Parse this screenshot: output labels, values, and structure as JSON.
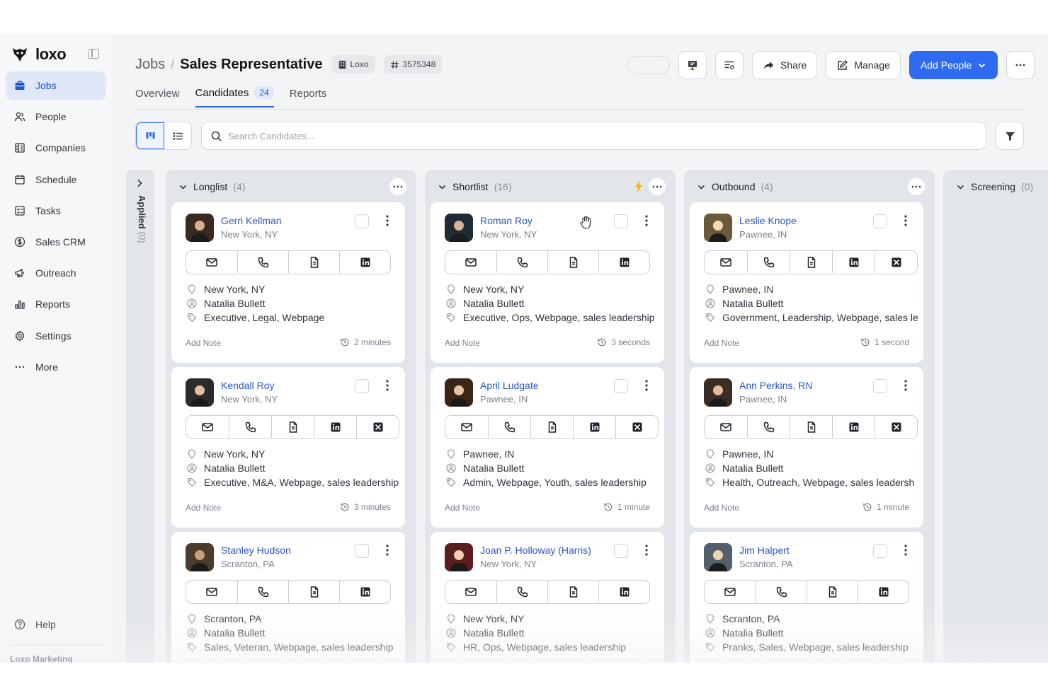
{
  "app": {
    "logo_text": "loxo"
  },
  "sidebar": {
    "items": [
      {
        "label": "Jobs",
        "icon": "briefcase-icon",
        "active": true
      },
      {
        "label": "People",
        "icon": "people-icon"
      },
      {
        "label": "Companies",
        "icon": "building-icon"
      },
      {
        "label": "Schedule",
        "icon": "calendar-icon"
      },
      {
        "label": "Tasks",
        "icon": "tasks-icon"
      },
      {
        "label": "Sales CRM",
        "icon": "dollar-icon"
      },
      {
        "label": "Outreach",
        "icon": "megaphone-icon"
      },
      {
        "label": "Reports",
        "icon": "bar-chart-icon"
      },
      {
        "label": "Settings",
        "icon": "gear-icon"
      },
      {
        "label": "More",
        "icon": "more-icon"
      }
    ],
    "help_label": "Help",
    "org_label": "Loxo Marketing"
  },
  "header": {
    "breadcrumb_root": "Jobs",
    "breadcrumb_sep": "/",
    "title": "Sales Representative",
    "company_chip": "Loxo",
    "id_chip": "3575348",
    "share_label": "Share",
    "manage_label": "Manage",
    "add_people_label": "Add People"
  },
  "tabs": {
    "overview": "Overview",
    "candidates": "Candidates",
    "candidates_count": "24",
    "reports": "Reports"
  },
  "search": {
    "placeholder": "Search Candidates..."
  },
  "board": {
    "applied": {
      "label": "Applied",
      "count": "(0)"
    },
    "columns": [
      {
        "title": "Longlist",
        "count": "(4)",
        "cards": [
          {
            "name": "Gerri Kellman",
            "location": "New York, NY",
            "city": "New York, NY",
            "owner": "Natalia Bullett",
            "tags": "Executive, Legal, Webpage",
            "note": "Add Note",
            "time": "2 minutes"
          },
          {
            "name": "Kendall Roy",
            "location": "New York, NY",
            "city": "New York, NY",
            "owner": "Natalia Bullett",
            "tags": "Executive, M&A, Webpage, sales leadership",
            "note": "Add Note",
            "time": "3 minutes"
          },
          {
            "name": "Stanley Hudson",
            "location": "Scranton, PA",
            "city": "Scranton, PA",
            "owner": "Natalia Bullett",
            "tags": "Sales, Veteran, Webpage, sales leadership",
            "note": "Add Note",
            "time": ""
          }
        ]
      },
      {
        "title": "Shortlist",
        "count": "(16)",
        "cards": [
          {
            "name": "Roman Roy",
            "location": "New York, NY",
            "city": "New York, NY",
            "owner": "Natalia Bullett",
            "tags": "Executive, Ops, Webpage, sales leadership",
            "note": "Add Note",
            "time": "3 seconds"
          },
          {
            "name": "April Ludgate",
            "location": "Pawnee, IN",
            "city": "Pawnee, IN",
            "owner": "Natalia Bullett",
            "tags": "Admin, Webpage, Youth, sales leadership",
            "note": "Add Note",
            "time": "1 minute"
          },
          {
            "name": "Joan P. Holloway (Harris)",
            "location": "New York, NY",
            "city": "New York, NY",
            "owner": "Natalia Bullett",
            "tags": "HR, Ops, Webpage, sales leadership",
            "note": "Add Note",
            "time": ""
          }
        ]
      },
      {
        "title": "Outbound",
        "count": "(4)",
        "cards": [
          {
            "name": "Leslie Knope",
            "location": "Pawnee, IN",
            "city": "Pawnee, IN",
            "owner": "Natalia Bullett",
            "tags": "Government, Leadership, Webpage, sales le",
            "note": "Add Note",
            "time": "1 second"
          },
          {
            "name": "Ann Perkins, RN",
            "location": "Pawnee, IN",
            "city": "Pawnee, IN",
            "owner": "Natalia Bullett",
            "tags": "Health, Outreach, Webpage, sales leadersh",
            "note": "Add Note",
            "time": "1 minute"
          },
          {
            "name": "Jim Halpert",
            "location": "Scranton, PA",
            "city": "Scranton, PA",
            "owner": "Natalia Bullett",
            "tags": "Pranks, Sales, Webpage, sales leadership",
            "note": "Add Note",
            "time": ""
          }
        ]
      },
      {
        "title": "Screening",
        "count": "(0)",
        "cards": []
      }
    ]
  },
  "colors": {
    "accent": "#2f6bf0",
    "link": "#2a55c7",
    "active_nav_bg": "#dfe7f8"
  }
}
